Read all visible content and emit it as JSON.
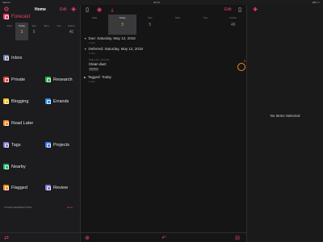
{
  "status": {
    "left": "Verizon",
    "time": "20:18",
    "right": "18% ▭"
  },
  "sidebar": {
    "title": "Home",
    "edit_label": "Edit",
    "forecast": {
      "label": "Forecast",
      "days": [
        {
          "name": "Past",
          "num": ""
        },
        {
          "name": "Today",
          "num": "3"
        },
        {
          "name": "Sun",
          "num": "5"
        },
        {
          "name": "Mon",
          "num": ""
        },
        {
          "name": "Tue",
          "num": ""
        },
        {
          "name": "Future",
          "num": "46"
        }
      ]
    },
    "perspectives": [
      {
        "label": "Inbox",
        "color": "#6e7fa8",
        "icon": "inbox-icon"
      },
      {
        "label": "Private",
        "color": "#e8463a",
        "icon": "house-icon"
      },
      {
        "label": "Research",
        "color": "#1fb84f",
        "icon": "research-icon"
      },
      {
        "label": "Blogging",
        "color": "#f7c21b",
        "icon": "blogging-icon"
      },
      {
        "label": "Errands",
        "color": "#2f8ef0",
        "icon": "errands-icon"
      },
      {
        "label": "Read Later",
        "color": "#f58a1f",
        "icon": "read-later-icon"
      },
      {
        "label": "Tags",
        "color": "#8a72d8",
        "icon": "tags-icon"
      },
      {
        "label": "Projects",
        "color": "#3a7cf0",
        "icon": "projects-icon"
      },
      {
        "label": "Nearby",
        "color": "#22b36b",
        "icon": "nearby-icon"
      },
      {
        "label": "Flagged",
        "color": "#f58a1f",
        "icon": "flag-icon"
      },
      {
        "label": "Review",
        "color": "#8a72d8",
        "icon": "review-icon"
      }
    ],
    "other_label": "OTHER PERSPECTIVES",
    "other_edit": "Done"
  },
  "main": {
    "edit_label": "Edit",
    "days": [
      {
        "name": "Past",
        "num": ""
      },
      {
        "name": "Today",
        "num": "3"
      },
      {
        "name": "Sun",
        "num": "5"
      },
      {
        "name": "Mon",
        "num": ""
      },
      {
        "name": "Tue",
        "num": ""
      },
      {
        "name": "Future",
        "num": "46"
      }
    ],
    "sections": [
      {
        "title": "Due: Saturday, May 12, 2018",
        "sub": "1 item"
      },
      {
        "title": "Deferred: Saturday, May 12, 2018",
        "sub": "1 item"
      },
      {
        "title": "Tagged: Today",
        "sub": "1 item"
      }
    ],
    "task": {
      "meta": "Daily Life • Errands",
      "name": "Clean duct",
      "chip": "Weekend"
    },
    "badge": "3"
  },
  "inspector": {
    "empty": "No Items Selected"
  },
  "colors": {
    "accent": "#f0406a",
    "forecast": "#e8406a",
    "warn": "#f5a623"
  }
}
